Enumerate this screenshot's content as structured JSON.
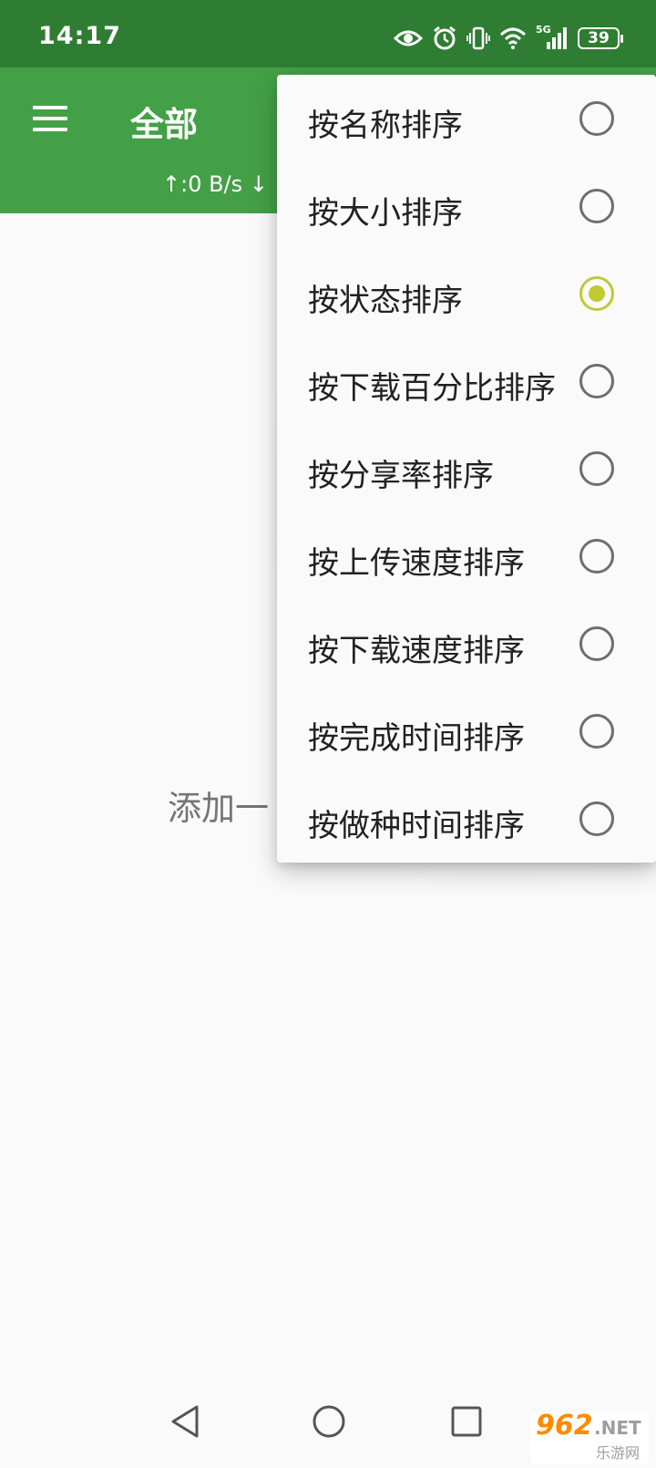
{
  "status_bar": {
    "time": "14:17",
    "battery": "39",
    "icons": [
      "eye-icon",
      "alarm-icon",
      "vibrate-icon",
      "wifi-icon",
      "signal-5g-icon",
      "battery-icon"
    ],
    "network_label": "5G"
  },
  "app_bar": {
    "title": "全部",
    "speed": "↑:0 B/s ↓",
    "menu_icon": "menu-icon"
  },
  "main": {
    "empty_hint": "添加一"
  },
  "sort_menu": {
    "items": [
      {
        "label": "按名称排序",
        "selected": false
      },
      {
        "label": "按大小排序",
        "selected": false
      },
      {
        "label": "按状态排序",
        "selected": true
      },
      {
        "label": "按下载百分比排序",
        "selected": false
      },
      {
        "label": "按分享率排序",
        "selected": false
      },
      {
        "label": "按上传速度排序",
        "selected": false
      },
      {
        "label": "按下载速度排序",
        "selected": false
      },
      {
        "label": "按完成时间排序",
        "selected": false
      },
      {
        "label": "按做种时间排序",
        "selected": false
      }
    ]
  },
  "nav_bar": {
    "buttons": [
      "back-icon",
      "home-icon",
      "recents-icon"
    ]
  },
  "watermark": {
    "top": "962",
    "suffix": ".NET",
    "bottom": "乐游网"
  },
  "colors": {
    "status_bar": "#2e7d32",
    "app_bar": "#43a047",
    "radio_selected": "#c0ca33",
    "radio_unselected": "#6e6e6e",
    "background": "#fafafa"
  }
}
